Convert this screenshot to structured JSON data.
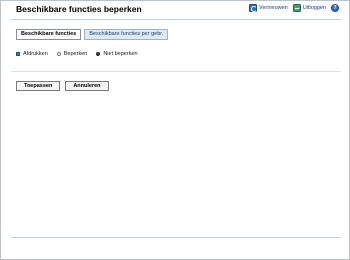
{
  "header": {
    "title": "Beschikbare functies beperken",
    "refresh_label": "Vernieuwen",
    "refresh_icon": "refresh-icon",
    "logout_label": "Uitloggen",
    "logout_icon": "logout-icon",
    "help_glyph": "?",
    "help_icon": "help-icon"
  },
  "tabs": [
    {
      "label": "Beschikbare functies",
      "active": true
    },
    {
      "label": "Beschikbare functies per gebr.",
      "active": false
    }
  ],
  "options": [
    {
      "label": "Afdrukken",
      "state": "indicator"
    },
    {
      "label": "Beperken",
      "state": "unchecked"
    },
    {
      "label": "Niet beperken",
      "state": "checked"
    }
  ],
  "buttons": {
    "apply_label": "Toepassen",
    "cancel_label": "Annuleren"
  },
  "colors": {
    "tab_inactive_bg": "#dce9f7",
    "link": "#1a3a8a",
    "accent": "#2f6dd0"
  }
}
